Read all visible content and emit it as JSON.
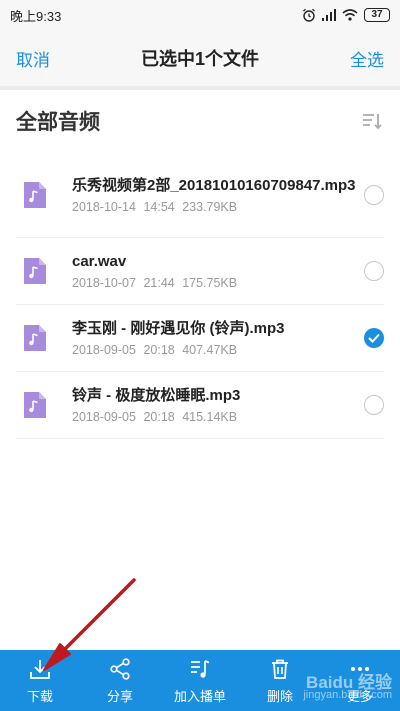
{
  "status_bar": {
    "time": "晚上9:33",
    "battery": "37"
  },
  "header": {
    "cancel_label": "取消",
    "title": "已选中1个文件",
    "select_all_label": "全选",
    "accent": "#1a8fe0"
  },
  "section": {
    "title": "全部音频"
  },
  "files": [
    {
      "name": "乐秀视频第2部_20181010160709847.mp3",
      "date": "2018-10-14",
      "time": "14:54",
      "size": "233.79KB",
      "selected": false
    },
    {
      "name": "car.wav",
      "date": "2018-10-07",
      "time": "21:44",
      "size": "175.75KB",
      "selected": false
    },
    {
      "name": "李玉刚 - 刚好遇见你 (铃声).mp3",
      "date": "2018-09-05",
      "time": "20:18",
      "size": "407.47KB",
      "selected": true
    },
    {
      "name": "铃声 - 极度放松睡眠.mp3",
      "date": "2018-09-05",
      "time": "20:18",
      "size": "415.14KB",
      "selected": false
    }
  ],
  "toolbar": {
    "download_label": "下载",
    "share_label": "分享",
    "add_to_playlist_label": "加入播单",
    "delete_label": "删除",
    "more_label": "更多"
  },
  "watermark": {
    "brand": "Baidu 经验",
    "url": "jingyan.baidu.com"
  },
  "colors": {
    "toolbar": "#1a8fe0",
    "audio_icon": "#a78bdc",
    "annotation_arrow": "#c0181f"
  }
}
